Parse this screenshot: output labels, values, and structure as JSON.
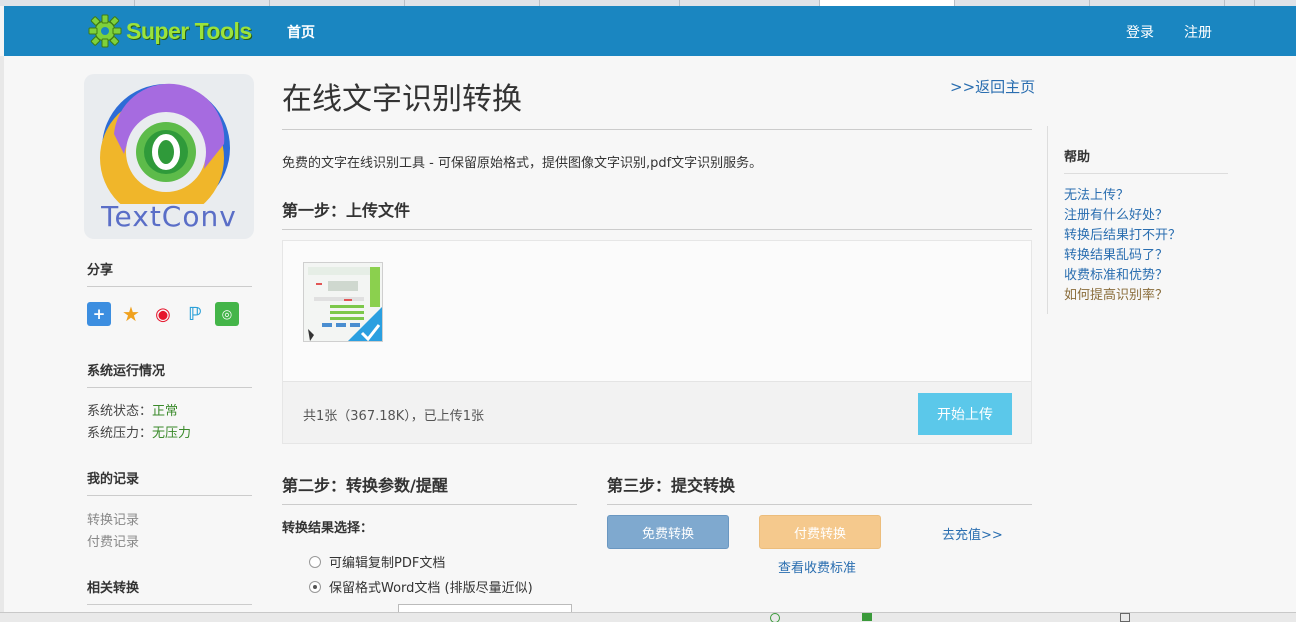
{
  "navbar": {
    "logo_text": "Super Tools",
    "home": "首页",
    "login": "登录",
    "register": "注册"
  },
  "sidebar": {
    "app_logo_text": "TextConv",
    "share_heading": "分享",
    "share_icons": [
      "plus-share-icon",
      "qzone-icon",
      "weibo-icon",
      "tencent-weibo-icon",
      "wechat-icon"
    ],
    "status_heading": "系统运行情况",
    "status_label": "系统状态：",
    "status_value": "正常",
    "pressure_label": "系统压力：",
    "pressure_value": "无压力",
    "records_heading": "我的记录",
    "record_links": [
      "转换记录",
      "付费记录"
    ],
    "related_heading": "相关转换"
  },
  "main": {
    "title": "在线文字识别转换",
    "back_link": ">>返回主页",
    "description": "免费的文字在线识别工具 - 可保留原始格式，提供图像文字识别,pdf文字识别服务。",
    "step1_heading": "第一步：上传文件",
    "upload_summary": "共1张（367.18K），已上传1张",
    "start_upload": "开始上传",
    "step2_heading": "第二步：转换参数/提醒",
    "choice_label": "转换结果选择：",
    "options": [
      {
        "label": "可编辑复制PDF文档",
        "checked": false
      },
      {
        "label": "保留格式Word文档 (排版尽量近似)",
        "checked": true
      }
    ],
    "step3_heading": "第三步：提交转换",
    "free_button": "免费转换",
    "paid_button": "付费转换",
    "recharge_link": "去充值>>",
    "fee_link": "查看收费标准"
  },
  "help": {
    "heading": "帮助",
    "links": [
      "无法上传？",
      "注册有什么好处？",
      "转换后结果打不开？",
      "转换结果乱码了？",
      "收费标准和优势？",
      "如何提高识别率？"
    ]
  },
  "colors": {
    "navbar": "#1a86c1",
    "logo_green": "#9be33c",
    "start_upload": "#5bc8ea",
    "free_button": "#7fa9cf",
    "paid_button": "#f5c98d",
    "link": "#2a6eb0",
    "status_ok": "#3a8a2a"
  }
}
